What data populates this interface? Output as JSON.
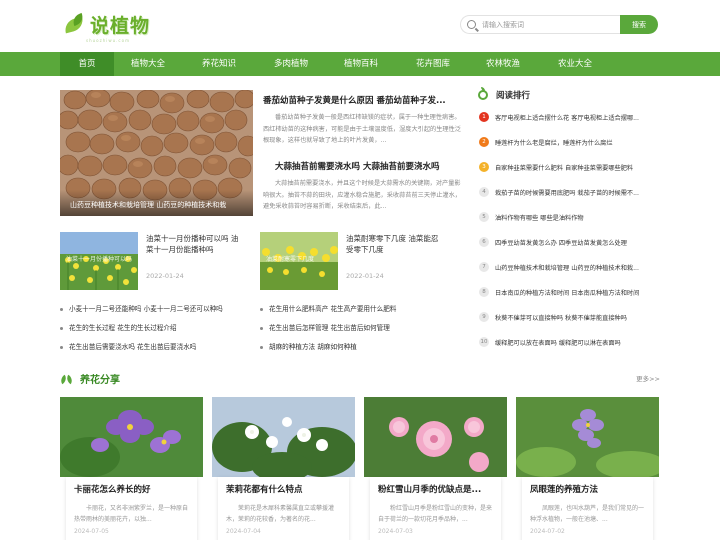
{
  "header": {
    "logo_text": "说植物",
    "logo_sub": "shuozhiwu.com",
    "search_placeholder": "请输入搜索词",
    "search_button": "搜索"
  },
  "nav": [
    "首页",
    "植物大全",
    "养花知识",
    "多肉植物",
    "植物百科",
    "花卉图库",
    "农林牧渔",
    "农业大全"
  ],
  "hero": {
    "caption": "山药豆种植技术和栽培管理 山药豆的种植技术和栽"
  },
  "featured": [
    {
      "title": "番茄幼苗种子发黄是什么原因 番茄幼苗种子发...",
      "excerpt": "番茄幼苗种子发黄一般是西红柿缺镁的症状，属于一种生理性病害。西红柿幼苗的这种病害，可能是由于土壤温度低，湿度大引起的生理性泛根现象，这样也就导致了地上的叶片发黄，..."
    },
    {
      "title": "大蒜抽苔前需要浇水吗 大蒜抽苔前要浇水吗",
      "excerpt": "大蒜抽苔前需要浇水，并且这个时候是大蒜需水的关键期，对产量影响很大。抽苔不蒜的田块，应灌水稳合施肥，采收蒜苔前三天停止灌水，避免采收蒜苔时容易折断，采收结束后，此..."
    }
  ],
  "small_posts": [
    {
      "title": "油菜十一月份播种可以吗 油菜十一月份能播种吗",
      "date": "2022-01-24",
      "thumb_caption": "油菜十一月份播种可以吗"
    },
    {
      "title": "油菜耐寒零下几度 油菜能忍受零下几度",
      "date": "2022-01-24",
      "thumb_caption": "油菜耐寒零下几度"
    }
  ],
  "links_left": [
    "小麦十一月二号还能种吗 小麦十一月二号还可以种吗",
    "花生的生长过程 花生的生长过程介绍",
    "花生出苗后需要浇水吗 花生出苗后要浇水吗"
  ],
  "links_right": [
    "花生用什么肥料高产 花生高产要用什么肥料",
    "花生出苗后怎样管理 花生出苗后如何管理",
    "胡麻的种植方法 胡麻如何种植"
  ],
  "ranking": {
    "title": "阅读排行",
    "items": [
      "客厅电视柜上适合摆什么花 客厅电视柜上适合摆哪...",
      "睡莲杆为什么老是腐烂，睡莲杆为什么腐烂",
      "自家种韭菜需要什么肥料 自家种韭菜需要哪些肥料",
      "栽茄子苗的时候需要用底肥吗 栽茄子苗的时候需不...",
      "油料作物有哪些 哪些是油料作物",
      "四季豆幼苗发黄怎么办 四季豆幼苗发黄怎么处理",
      "山药豆种植技术和栽培管理 山药豆的种植技术和栽...",
      "日本南瓜的种植方法和时间 日本南瓜种植方法和时间",
      "秋葵不催芽可以直接种吗 秋葵不催芽能直接种吗",
      "缓释肥可以放在表面吗 缓释肥可以淋在表面吗"
    ]
  },
  "share": {
    "title": "养花分享",
    "more": "更多>>",
    "cards": [
      {
        "title": "卡丽花怎么养长的好",
        "text": "卡丽花，又名非洲紫罗兰，是一种原自热带雨林的美丽花卉，以独...",
        "date": "2024-07-05"
      },
      {
        "title": "茉莉花都有什么特点",
        "text": "茉莉花是木犀科素馨属直立或攀援灌木，茉莉的花较香，为著名的花...",
        "date": "2024-07-04"
      },
      {
        "title": "粉红雪山月季的优缺点是...",
        "text": "粉红雪山月季是粉红雪山的变种，是来自于荷兰的一款切花月季品种，...",
        "date": "2024-07-03"
      },
      {
        "title": "凤眼莲的养殖方法",
        "text": "凤眼莲，也叫水葫芦，是我们常见的一种浮水植物，一般在池塘、...",
        "date": "2024-07-02"
      }
    ]
  },
  "colors": {
    "primary": "#5aa83b",
    "nav_active": "#3f8d28"
  }
}
